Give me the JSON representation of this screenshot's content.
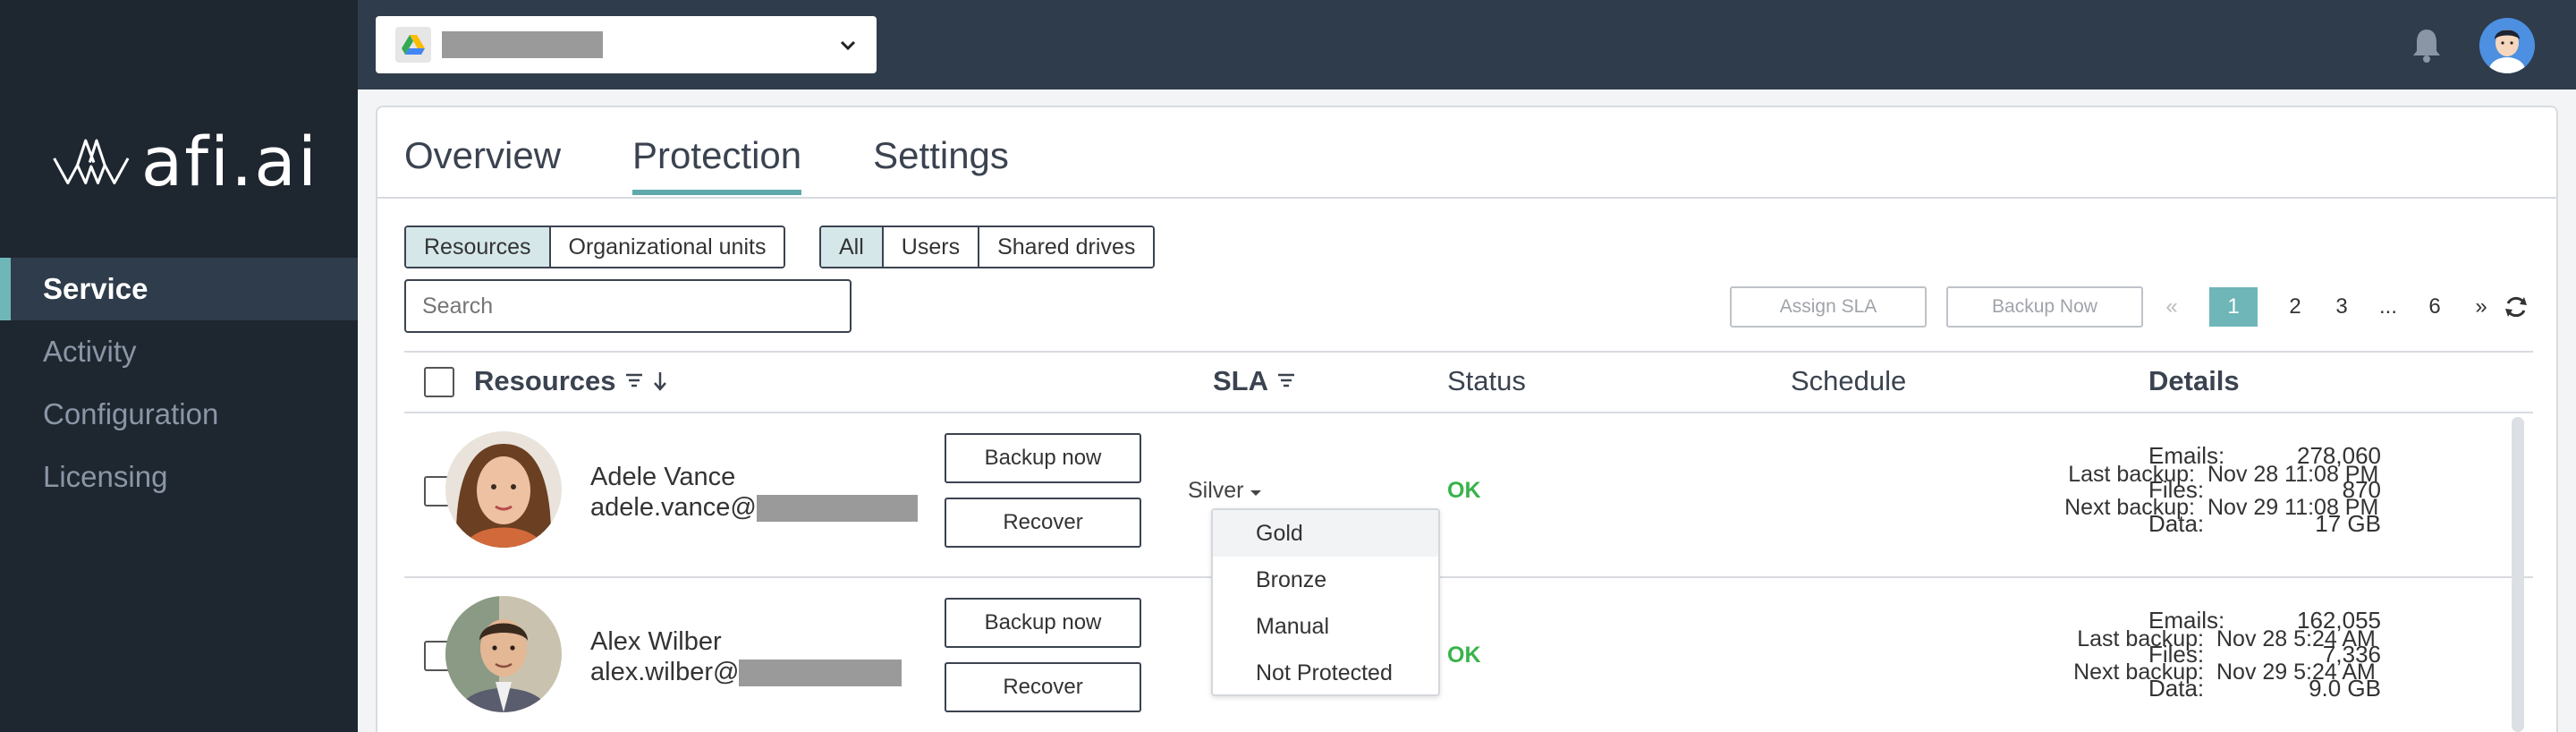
{
  "sidebar": {
    "logo_text": "afi.ai",
    "items": [
      {
        "label": "Service",
        "active": true
      },
      {
        "label": "Activity",
        "active": false
      },
      {
        "label": "Configuration",
        "active": false
      },
      {
        "label": "Licensing",
        "active": false
      }
    ]
  },
  "topbar": {
    "tenant_icon": "google-drive-icon",
    "notification_icon": "bell-icon",
    "avatar_icon": "user-avatar-icon"
  },
  "tabs": [
    {
      "label": "Overview",
      "active": false
    },
    {
      "label": "Protection",
      "active": true
    },
    {
      "label": "Settings",
      "active": false
    }
  ],
  "filters": {
    "scope": [
      {
        "label": "Resources",
        "selected": true
      },
      {
        "label": "Organizational units",
        "selected": false
      }
    ],
    "type": [
      {
        "label": "All",
        "selected": true
      },
      {
        "label": "Users",
        "selected": false
      },
      {
        "label": "Shared drives",
        "selected": false
      }
    ]
  },
  "search": {
    "placeholder": "Search"
  },
  "actions": {
    "assign_sla": "Assign SLA",
    "backup_now": "Backup Now"
  },
  "pagination": {
    "prev": "«",
    "pages": [
      "1",
      "2",
      "3",
      "...",
      "6"
    ],
    "current": "1",
    "next": "»",
    "refresh_icon": "refresh-icon"
  },
  "table": {
    "headers": {
      "resources": "Resources",
      "sla": "SLA",
      "status": "Status",
      "schedule": "Schedule",
      "details": "Details"
    },
    "rows": [
      {
        "name": "Adele Vance",
        "email_prefix": "adele.vance@",
        "backup_button": "Backup now",
        "recover_button": "Recover",
        "sla": "Silver",
        "status": "OK",
        "last_backup_label": "Last backup:",
        "last_backup": "Nov 28 11:08 PM",
        "next_backup_label": "Next backup:",
        "next_backup": "Nov 29 11:08 PM",
        "emails_label": "Emails:",
        "emails": "278,060",
        "files_label": "Files:",
        "files": "870",
        "data_label": "Data:",
        "data": "17 GB"
      },
      {
        "name": "Alex Wilber",
        "email_prefix": "alex.wilber@",
        "backup_button": "Backup now",
        "recover_button": "Recover",
        "sla": "",
        "status": "OK",
        "last_backup_label": "Last backup:",
        "last_backup": "Nov 28 5:24 AM",
        "next_backup_label": "Next backup:",
        "next_backup": "Nov 29 5:24 AM",
        "emails_label": "Emails:",
        "emails": "162,055",
        "files_label": "Files:",
        "files": "7,336",
        "data_label": "Data:",
        "data": "9.0 GB"
      }
    ]
  },
  "sla_dropdown": {
    "options": [
      "Gold",
      "Bronze",
      "Manual",
      "Not Protected"
    ],
    "highlighted": "Gold"
  },
  "colors": {
    "sidebar_bg": "#1e2630",
    "topbar_bg": "#2f3c4b",
    "accent": "#6fb6b8",
    "status_ok": "#38b34a"
  }
}
